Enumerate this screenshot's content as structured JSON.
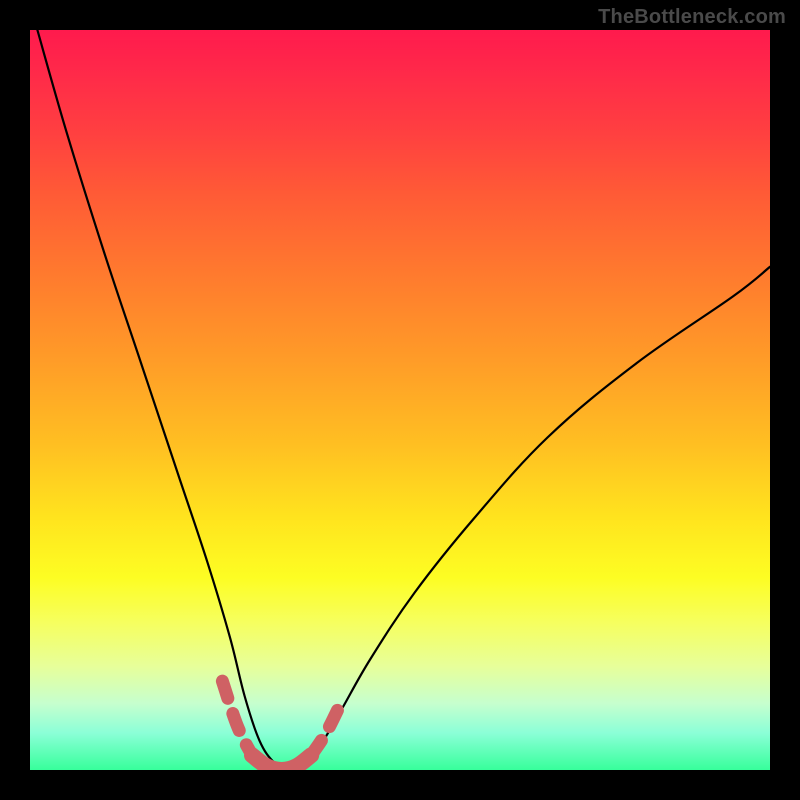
{
  "watermark": "TheBottleneck.com",
  "colors": {
    "frame_bg": "#000000",
    "curve_stroke": "#000000",
    "marker_stroke": "#cf6164",
    "gradient_top": "#ff1a4d",
    "gradient_bottom": "#37ff9b"
  },
  "chart_data": {
    "type": "line",
    "title": "",
    "xlabel": "",
    "ylabel": "",
    "xlim": [
      0,
      100
    ],
    "ylim": [
      0,
      100
    ],
    "grid": false,
    "legend": false,
    "annotations": [
      {
        "text": "TheBottleneck.com",
        "position": "top-right"
      }
    ],
    "background_gradient": {
      "direction": "vertical",
      "stops": [
        {
          "pos": 0.0,
          "color": "#ff1a4d"
        },
        {
          "pos": 0.33,
          "color": "#ff7a2e"
        },
        {
          "pos": 0.66,
          "color": "#ffe41e"
        },
        {
          "pos": 1.0,
          "color": "#37ff9b"
        }
      ]
    },
    "series": [
      {
        "name": "bottleneck-curve",
        "note": "Y is bottleneck percentage (0 at optimal), descending left branch, ascending right branch. X is a relative match axis (not labeled in source).",
        "x": [
          1,
          5,
          10,
          15,
          20,
          24,
          27,
          29,
          31,
          33,
          35,
          37,
          39,
          42,
          46,
          52,
          60,
          70,
          82,
          95,
          100
        ],
        "y": [
          100,
          86,
          70,
          55,
          40,
          28,
          18,
          10,
          4,
          1,
          0,
          1,
          3,
          8,
          15,
          24,
          34,
          45,
          55,
          64,
          68
        ]
      },
      {
        "name": "optimal-region",
        "note": "dotted salmon overlay near valley where bottleneck is acceptable",
        "x": [
          26,
          28,
          30,
          32,
          34,
          36,
          38,
          40,
          42
        ],
        "y": [
          12,
          6,
          2,
          0.5,
          0,
          0.5,
          2,
          5,
          9
        ]
      }
    ]
  }
}
